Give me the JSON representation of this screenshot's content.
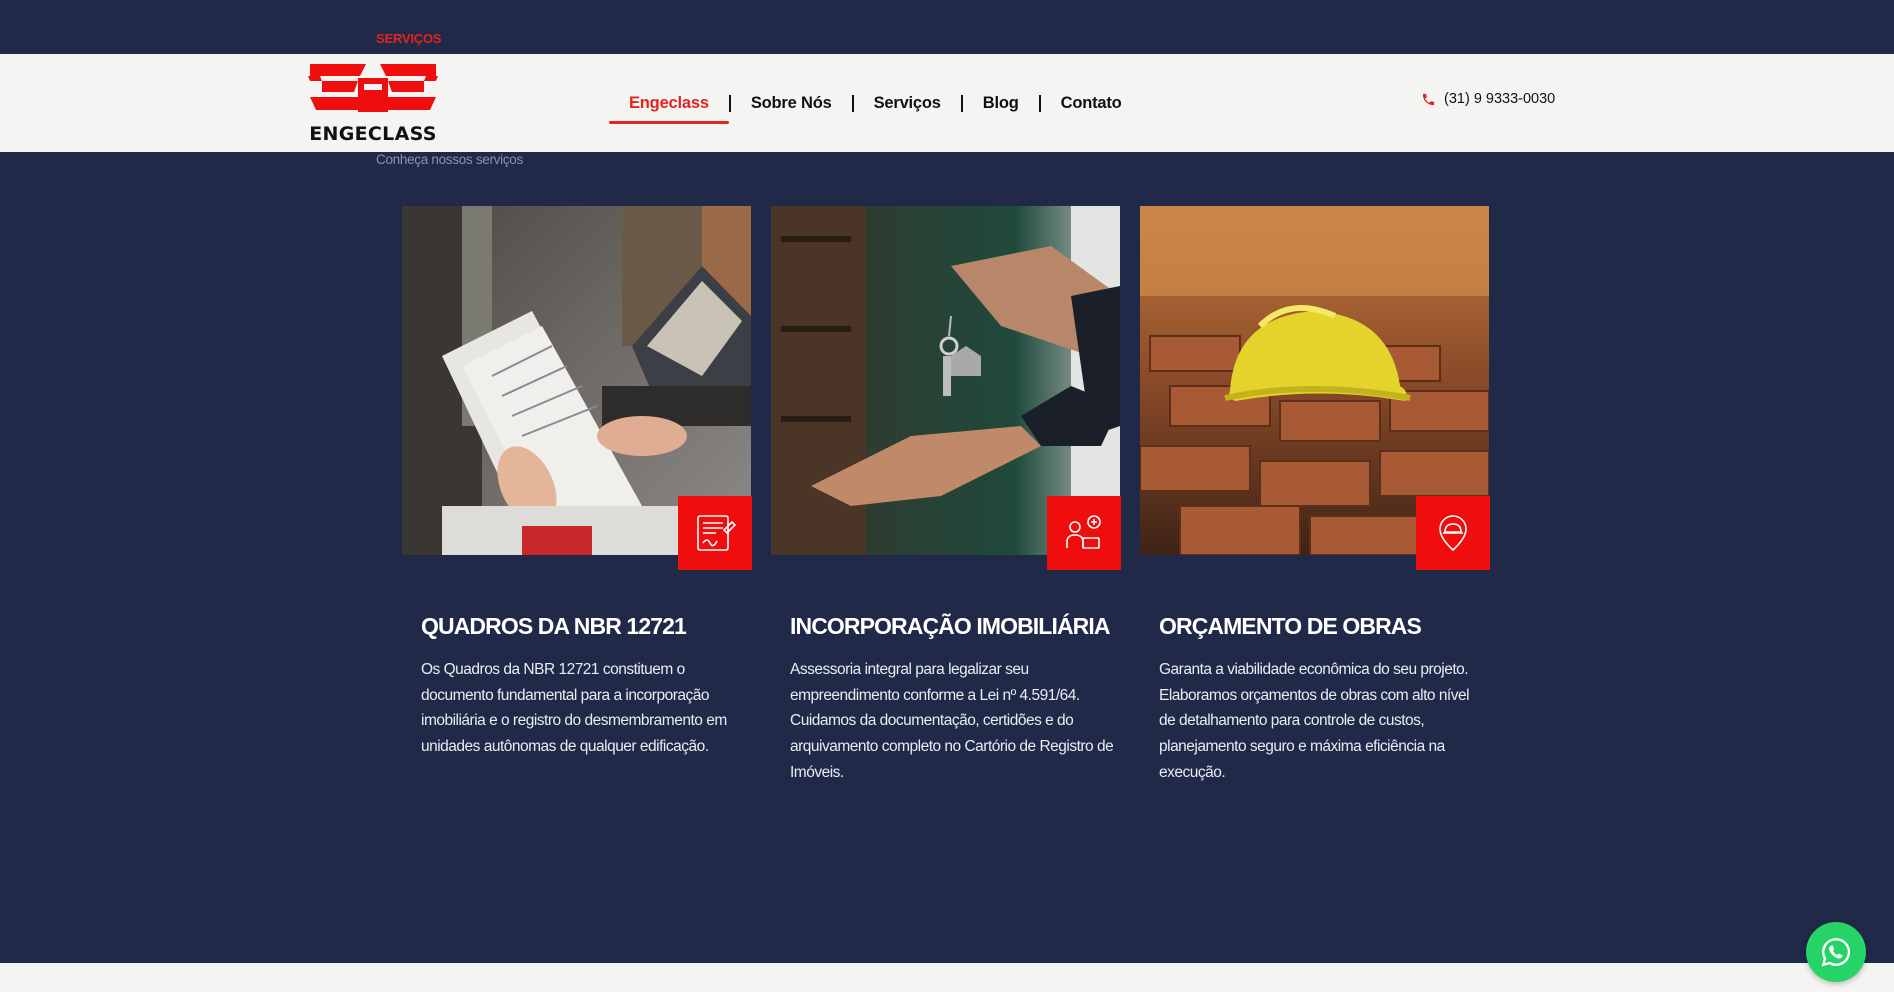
{
  "section": {
    "eyebrow": "SERVIÇOS",
    "subtitle": "Conheça nossos serviços"
  },
  "header": {
    "logo_text": "ENGECLASS",
    "nav": [
      {
        "label": "Engeclass",
        "active": true
      },
      {
        "label": "Sobre Nós",
        "active": false
      },
      {
        "label": "Serviços",
        "active": false
      },
      {
        "label": "Blog",
        "active": false
      },
      {
        "label": "Contato",
        "active": false
      }
    ],
    "phone": "(31) 9 9333-0030"
  },
  "cards": [
    {
      "title": "QUADROS DA NBR 12721",
      "text": "Os Quadros da NBR 12721 constituem o documento fundamental para a incorporação imobiliária e o registro do desmembramento em unidades autônomas de qualquer edificação.",
      "image": "hands-holding-documents-photo",
      "icon": "document-signature-icon"
    },
    {
      "title": "INCORPORAÇÃO IMOBILIÁRIA",
      "text": "Assessoria integral para legalizar seu empreendimento conforme a Lei nº 4.591/64. Cuidamos da documentação, certidões e do arquivamento completo no Cartório de Registro de Imóveis.",
      "image": "house-keys-handover-photo",
      "icon": "consultant-icon"
    },
    {
      "title": "ORÇAMENTO DE OBRAS",
      "text": "Garanta a viabilidade econômica do seu projeto. Elaboramos orçamentos de obras com alto nível de detalhamento para controle de custos, planejamento seguro e máxima eficiência na execução.",
      "image": "hard-hat-on-bricks-photo",
      "icon": "helmet-location-icon"
    }
  ],
  "colors": {
    "accent": "#e4231f",
    "badge": "#f00d0d",
    "background": "#202a48",
    "header_bg": "#f4f5f3",
    "whatsapp": "#25d366"
  }
}
